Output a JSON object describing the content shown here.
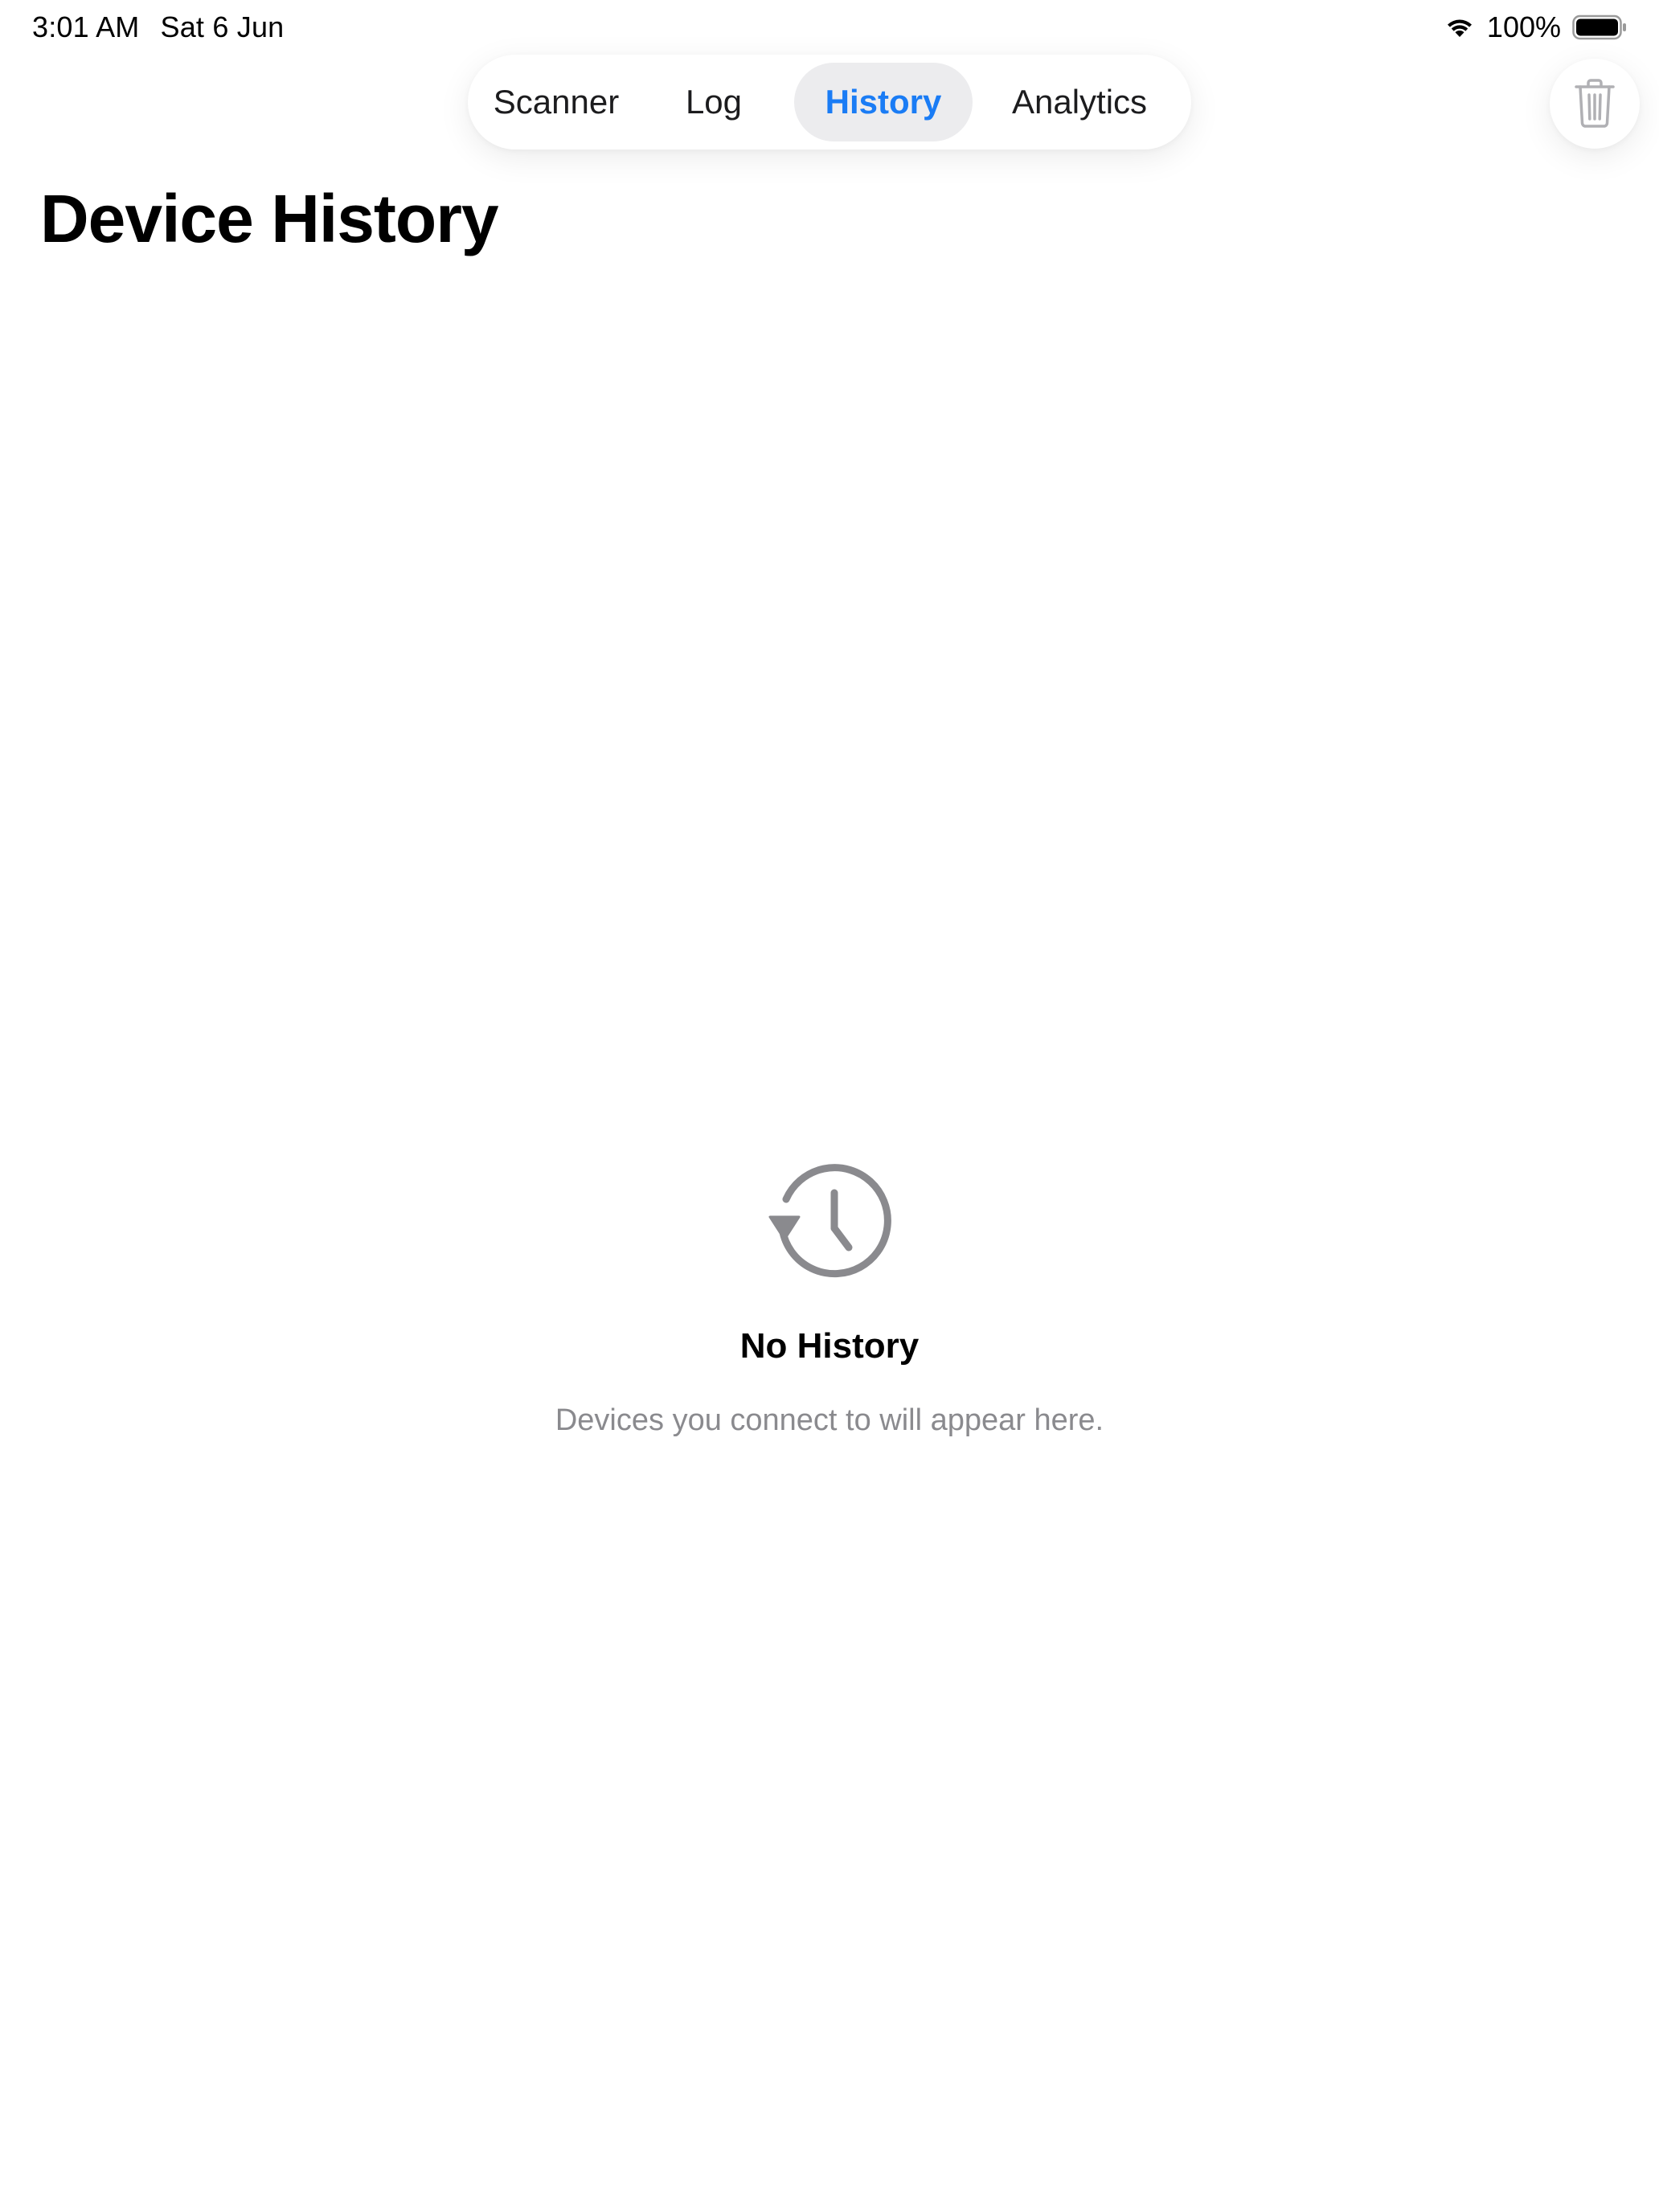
{
  "status_bar": {
    "time": "3:01 AM",
    "date": "Sat 6 Jun",
    "battery_percent": "100%",
    "wifi_icon": "wifi-icon",
    "battery_icon": "battery-full-icon"
  },
  "tabs": [
    {
      "label": "Scanner",
      "active": false
    },
    {
      "label": "Log",
      "active": false
    },
    {
      "label": "History",
      "active": true
    },
    {
      "label": "Analytics",
      "active": false
    }
  ],
  "toolbar": {
    "trash_icon": "trash-icon"
  },
  "page": {
    "title": "Device History"
  },
  "empty_state": {
    "icon": "clock-history-icon",
    "title": "No History",
    "subtitle": "Devices you connect to will appear here."
  },
  "colors": {
    "accent": "#1a7cf5",
    "active_tab_bg": "#ececee",
    "secondary_text": "#8a8a8e",
    "icon_gray": "#8a8a8e"
  }
}
